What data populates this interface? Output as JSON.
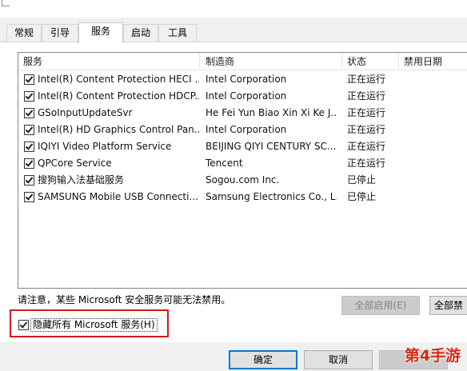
{
  "tabs": [
    {
      "label": "常规"
    },
    {
      "label": "引导"
    },
    {
      "label": "服务"
    },
    {
      "label": "启动"
    },
    {
      "label": "工具"
    }
  ],
  "active_tab": "服务",
  "columns": {
    "name": "服务",
    "manufacturer": "制造商",
    "status": "状态",
    "disabled_date": "禁用日期"
  },
  "services": [
    {
      "name": "Intel(R) Content Protection HECI ...",
      "manufacturer": "Intel Corporation",
      "status": "正在运行",
      "checked": true
    },
    {
      "name": "Intel(R) Content Protection HDCP...",
      "manufacturer": "Intel Corporation",
      "status": "正在运行",
      "checked": true
    },
    {
      "name": "GSoInputUpdateSvr",
      "manufacturer": "He Fei Yun Biao Xin Xi Ke J...",
      "status": "正在运行",
      "checked": true
    },
    {
      "name": "Intel(R) HD Graphics Control Pan...",
      "manufacturer": "Intel Corporation",
      "status": "正在运行",
      "checked": true
    },
    {
      "name": "IQIYI Video Platform Service",
      "manufacturer": "BEIJING QIYI CENTURY SC...",
      "status": "正在运行",
      "checked": true
    },
    {
      "name": "QPCore Service",
      "manufacturer": "Tencent",
      "status": "正在运行",
      "checked": true
    },
    {
      "name": "搜狗输入法基础服务",
      "manufacturer": "Sogou.com Inc.",
      "status": "已停止",
      "checked": true
    },
    {
      "name": "SAMSUNG Mobile USB Connecti...",
      "manufacturer": "Samsung Electronics Co., L...",
      "status": "已停止",
      "checked": true
    }
  ],
  "note": "请注意，某些 Microsoft 安全服务可能无法禁用。",
  "buttons": {
    "enable_all": "全部启用(E)",
    "disable_all": "全部禁",
    "ok": "确定",
    "cancel": "取消"
  },
  "hide_ms": {
    "label": "隐藏所有 Microsoft 服务(H)",
    "checked": true
  },
  "watermark": "第4手游",
  "colors": {
    "highlight_border": "#d21a1a",
    "primary_border": "#0078d7",
    "watermark": "#d42a14"
  }
}
